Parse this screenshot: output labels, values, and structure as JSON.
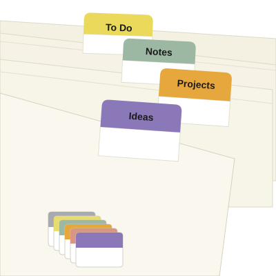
{
  "tabs": [
    {
      "label": "To Do",
      "color": "#ead95a"
    },
    {
      "label": "Notes",
      "color": "#9cb8a3"
    },
    {
      "label": "Projects",
      "color": "#e6a83c"
    },
    {
      "label": "Ideas",
      "color": "#8a78b8"
    }
  ],
  "stack_colors": [
    "#a8aab0",
    "#e6dd6e",
    "#9cb8a3",
    "#e6a83c",
    "#d99684",
    "#8a78b8"
  ],
  "folder_color": "#f9f7ee"
}
